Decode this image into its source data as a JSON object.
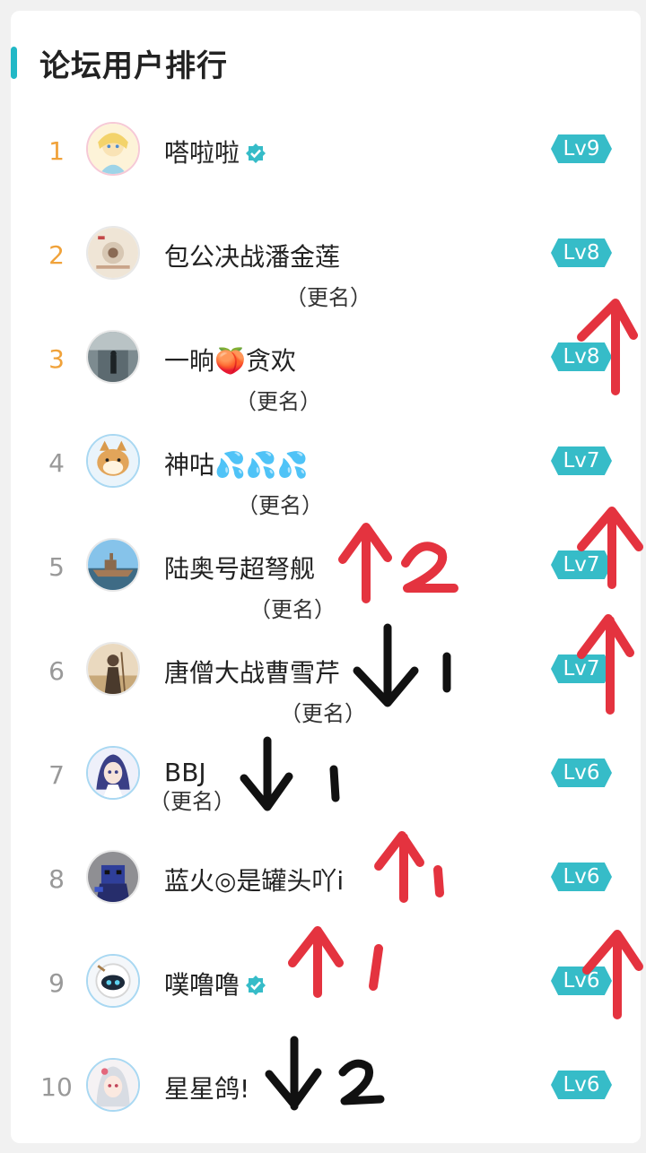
{
  "title": "论坛用户排行",
  "colors": {
    "accent": "#36bcc8",
    "top_rank": "#f0a23a",
    "arrow_red": "#e4333f",
    "arrow_black": "#111111"
  },
  "users": [
    {
      "rank": "1",
      "name": "嗒啦啦",
      "verified": true,
      "rename": "",
      "level": "Lv9"
    },
    {
      "rank": "2",
      "name": "包公决战潘金莲",
      "verified": false,
      "rename": "（更名）",
      "level": "Lv8"
    },
    {
      "rank": "3",
      "name": "一晌🍑贪欢",
      "verified": false,
      "rename": "（更名）",
      "level": "Lv8"
    },
    {
      "rank": "4",
      "name": "神咕💦💦💦",
      "verified": false,
      "rename": "（更名）",
      "level": "Lv7"
    },
    {
      "rank": "5",
      "name": "陆奥号超弩舰",
      "verified": false,
      "rename": "（更名）",
      "level": "Lv7"
    },
    {
      "rank": "6",
      "name": "唐僧大战曹雪芹",
      "verified": false,
      "rename": "（更名）",
      "level": "Lv7"
    },
    {
      "rank": "7",
      "name": "BBJ",
      "verified": false,
      "rename": "（更名）",
      "level": "Lv6"
    },
    {
      "rank": "8",
      "name": "蓝火◎是罐头吖i",
      "verified": false,
      "rename": "",
      "level": "Lv6"
    },
    {
      "rank": "9",
      "name": "噗噜噜",
      "verified": true,
      "rename": "",
      "level": "Lv6"
    },
    {
      "rank": "10",
      "name": "星星鸽!",
      "verified": false,
      "rename": "",
      "level": "Lv6"
    }
  ],
  "annotations": [
    {
      "row": "5",
      "direction": "up",
      "number": "2",
      "color": "red"
    },
    {
      "row": "6",
      "direction": "down",
      "number": "1",
      "color": "black"
    },
    {
      "row": "7",
      "direction": "down",
      "number": "1",
      "color": "black"
    },
    {
      "row": "8",
      "direction": "up",
      "number": "1",
      "color": "red"
    },
    {
      "row": "9",
      "direction": "up",
      "number": "1",
      "color": "red"
    },
    {
      "row": "10",
      "direction": "down",
      "number": "2",
      "color": "black"
    }
  ]
}
